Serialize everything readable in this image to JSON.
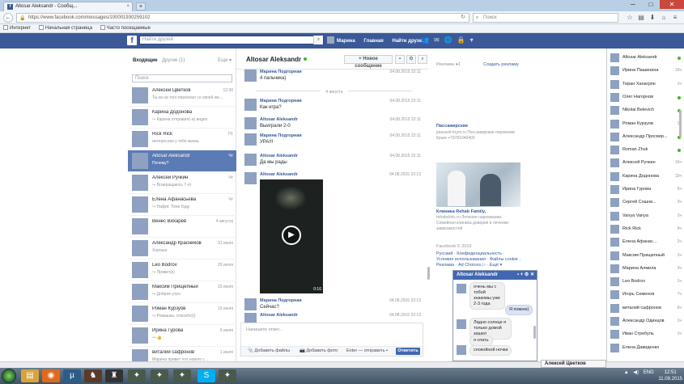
{
  "browser": {
    "tab_title": "Altosar Aleksandr - Сообщ...",
    "url": "https://www.facebook.com/messages/100001930259102",
    "search_placeholder": "Поиск",
    "bookmarks": [
      "Интернет",
      "Начальная страница",
      "Часто посещаемые"
    ]
  },
  "fb": {
    "logo": "f",
    "search_placeholder": "Найти друзей",
    "nav": [
      "Марина",
      "Главная",
      "Найти друзей"
    ]
  },
  "inbox": {
    "tab_inbox": "Входящие",
    "tab_other": "Другие (1)",
    "more": "Еще ▾",
    "search_placeholder": "Поиск",
    "conversations": [
      {
        "name": "Алексей Цветков",
        "snippet": "Ты из-за того переехал со своей же...",
        "time": "12:30",
        "selected": false
      },
      {
        "name": "Карина Додонова",
        "snippet": "↪ Карина отправил(-а) видео",
        "time": "",
        "selected": false
      },
      {
        "name": "Rick Rick",
        "snippet": "интересная у тебя жизнь",
        "time": "Пт",
        "selected": false
      },
      {
        "name": "Altosar Aleksandr",
        "snippet": "Почему?",
        "time": "Чт",
        "selected": true
      },
      {
        "name": "Алексей Ручкин",
        "snippet": "↪ Возвращаюсь 7-го",
        "time": "Чт",
        "selected": false
      },
      {
        "name": "Елена Афанасьева",
        "snippet": "↪ Нафиг. Тоже буду",
        "time": "Чт",
        "selected": false
      },
      {
        "name": "Венес Вихарев",
        "snippet": "",
        "time": "4 августа",
        "selected": false
      },
      {
        "name": "Александр Красников",
        "snippet": "Хорошо",
        "time": "31 июля",
        "selected": false
      },
      {
        "name": "Leo Bodrov",
        "snippet": "↪ Привет(к)",
        "time": "29 июля",
        "selected": false
      },
      {
        "name": "Максим Прищепный",
        "snippet": "↪ Доброе утро",
        "time": "23 июля",
        "selected": false
      },
      {
        "name": "Роман Курзуов",
        "snippet": "↪ Ромашка, спасибо)))",
        "time": "19 июля",
        "selected": false
      },
      {
        "name": "Ирина Гурова",
        "snippet": "↪ 👍",
        "time": "9 июля",
        "selected": false
      },
      {
        "name": "виталий сафронов",
        "snippet": "Марина привет что нового с ...",
        "time": "1 июля",
        "selected": false
      }
    ]
  },
  "chat": {
    "name": "Altosar Aleksandr",
    "new_message": "+ Новое сообщение",
    "date_separator": "4 августа",
    "messages": [
      {
        "name": "Марина Подгорная",
        "text": "4 пальчика)",
        "time": "04.08.2015 22:11"
      },
      {
        "name": "Марина Подгорная",
        "text": "Как игра?",
        "time": "04.08.2015 22:11"
      },
      {
        "name": "Altosar Aleksandr",
        "text": "Выиграли 2-0",
        "time": "04.08.2015 22:11"
      },
      {
        "name": "Марина Подгорная",
        "text": "УРА!!!",
        "time": "04.08.2015 22:11"
      },
      {
        "name": "Altosar Aleksandr",
        "text": "Да мы рады",
        "time": "04.08.2015 22:11"
      },
      {
        "name": "Altosar Aleksandr",
        "text": "",
        "time": "04.08.2015 22:13"
      },
      {
        "name": "Марина Подгорная",
        "text": "Сейчас?",
        "time": "04.08.2015 22:13"
      },
      {
        "name": "Altosar Aleksandr",
        "text": "",
        "time": "04.08.2015 22:13"
      }
    ],
    "video_time": "0:16",
    "compose_placeholder": "Напишите ответ...",
    "attach_files": "Добавить файлы",
    "attach_photo": "Добавить фото",
    "enter_hint": "Enter — отправить",
    "send": "Ответить"
  },
  "ads": {
    "header": "Реклама ●1",
    "create": "Создать рекламу",
    "ad1_name": "Пассажирские",
    "ad1_text": "passazir-krym.ru Пассажирские перевозки Крым +79781040400",
    "ad2_name": "Клиника Rehab Family,",
    "ad2_text": "rehabclinic.ru Лечение наркомании. Семейная клиника доверия в лечении зависимостей",
    "copyright": "Facebook © 2015",
    "links": "Русский · Конфиденциальность · Условия использования · Файлы cookie · Реклама · Ad Choices ▷ · Ещё ▾"
  },
  "popup": {
    "name": "Altosar Aleksandr",
    "bubbles": [
      {
        "text": "очень мы с тобой знакомы уже 2-3 года",
        "me": false
      },
      {
        "text": "Я помню)",
        "me": true
      },
      {
        "text": "Ладно солнце я только домой зашел",
        "me": false
      },
      {
        "text": "я спать",
        "me": false
      },
      {
        "text": "спокойной ночки",
        "me": false
      }
    ]
  },
  "contacts": [
    {
      "name": "Altosar Aleksandr",
      "status": "●"
    },
    {
      "name": "Ирина Пашинина",
      "status": "16ч"
    },
    {
      "name": "Тиран Ханагрян",
      "status": "1ч"
    },
    {
      "name": "Олег Нагорнов",
      "status": "●"
    },
    {
      "name": "Nikolai Belevich",
      "status": "●"
    },
    {
      "name": "Роман Курзуов",
      "status": "1ч"
    },
    {
      "name": "Александр Просвир...",
      "status": "●"
    },
    {
      "name": "Roman Zhuk",
      "status": "●"
    },
    {
      "name": "Алексей Ручкин",
      "status": "16ч"
    },
    {
      "name": "Карина Додонова",
      "status": "15ч"
    },
    {
      "name": "Ирина Гурова",
      "status": "5ч"
    },
    {
      "name": "Сергей Сошни...",
      "status": "3ч"
    },
    {
      "name": "Vanya Vanya",
      "status": "1ч"
    },
    {
      "name": "Rick Rick",
      "status": "9ч"
    },
    {
      "name": "Елена Афанас...",
      "status": "2ч"
    },
    {
      "name": "Максим Прищепный",
      "status": "1ч"
    },
    {
      "name": "Марина Алмила",
      "status": "3ч"
    },
    {
      "name": "Leo Bodrov",
      "status": "1ч"
    },
    {
      "name": "Игорь Семенов",
      "status": "7ч"
    },
    {
      "name": "виталий сафронов",
      "status": "6ч"
    },
    {
      "name": "Александр Одинцов",
      "status": "1ч"
    },
    {
      "name": "Иван Стребуль",
      "status": "1ч"
    },
    {
      "name": "Елена Давиденко",
      "status": ""
    }
  ],
  "chat_tab": "Алексей Цветков",
  "taskbar": {
    "lang": "ENG",
    "time": "12:51",
    "date": "11.08.2015"
  },
  "colors": {
    "fb_blue": "#3b5998",
    "selected_row": "#5b7bb5",
    "link": "#365899",
    "online": "#42b72a"
  }
}
